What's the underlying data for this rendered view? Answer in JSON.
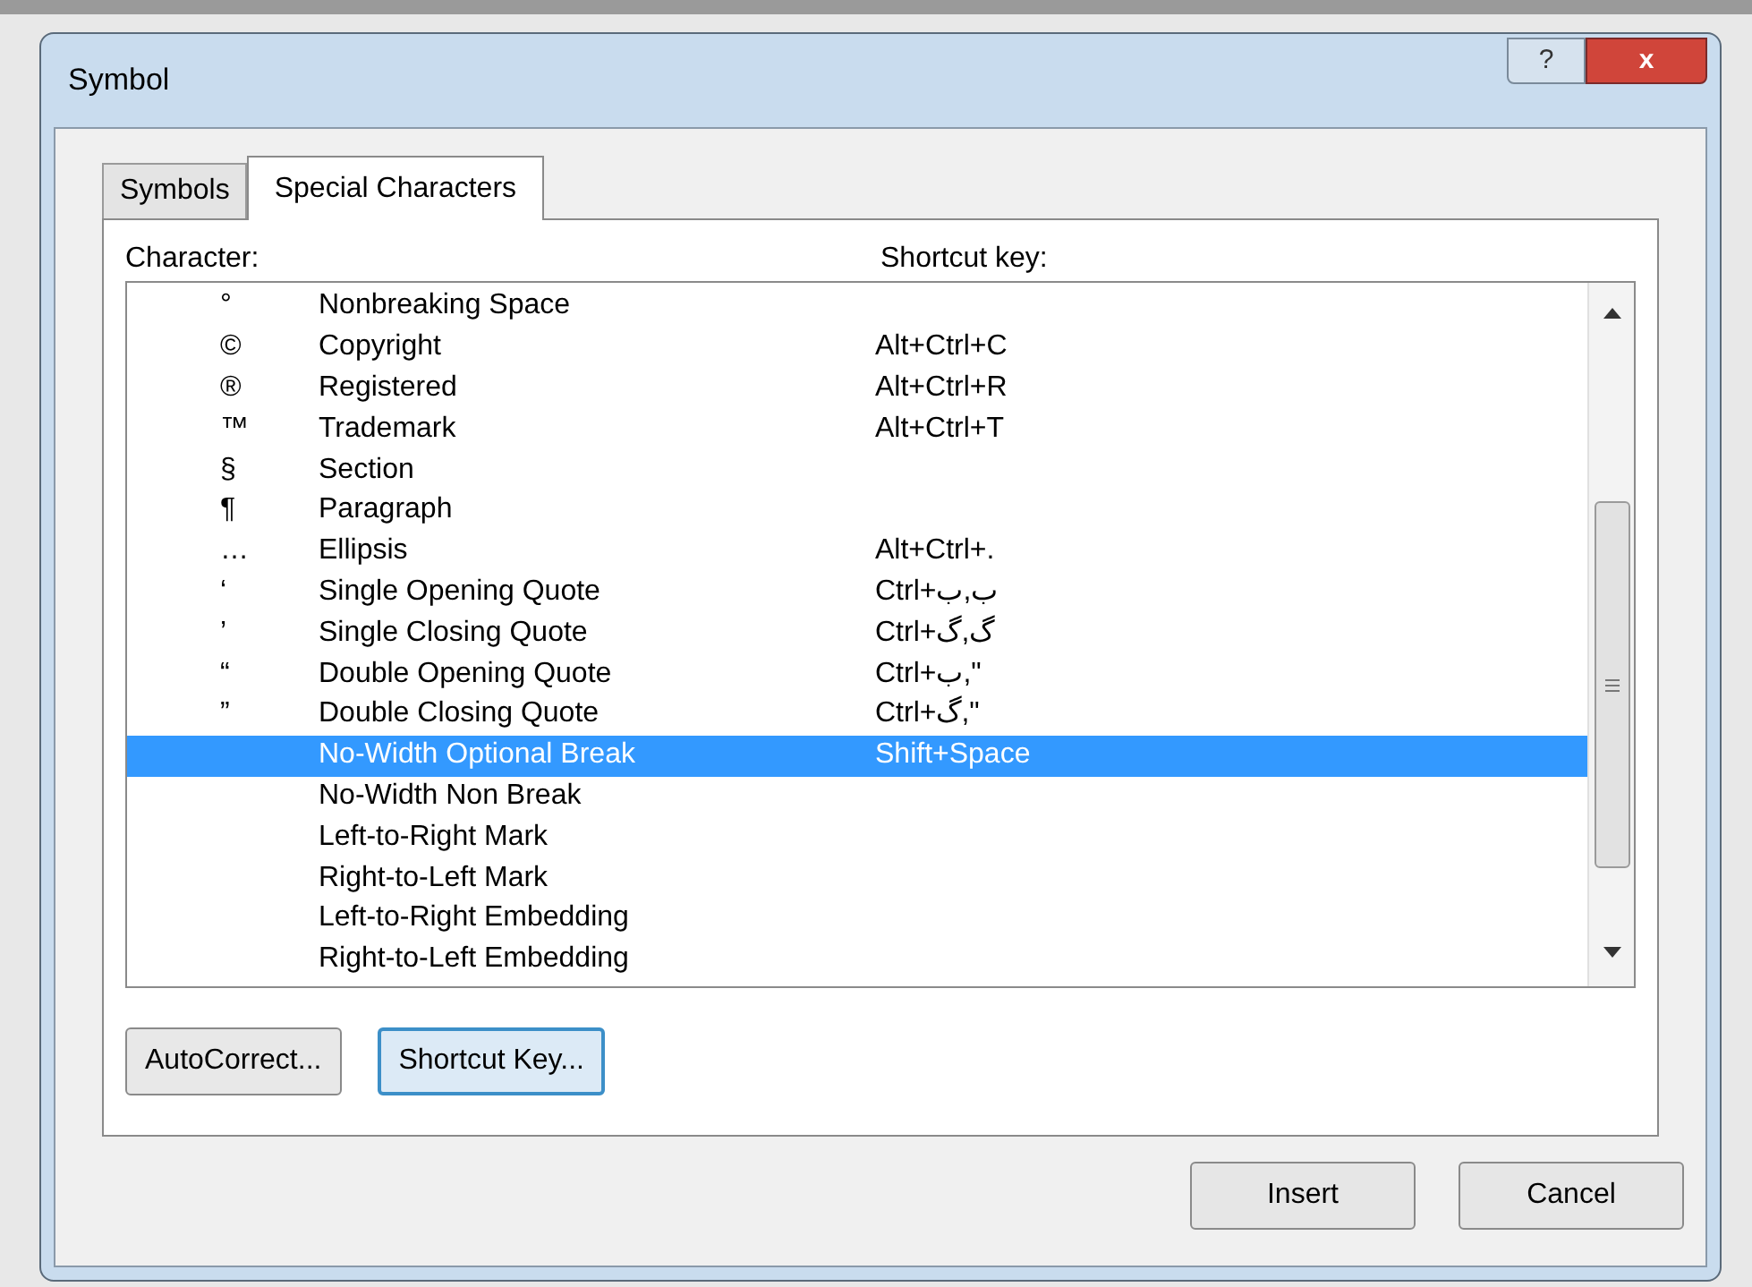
{
  "window": {
    "title": "Symbol",
    "help_button": "?",
    "close_button": "x"
  },
  "tabs": [
    {
      "label": "Symbols",
      "selected": false
    },
    {
      "label": "Special Characters",
      "selected": true
    }
  ],
  "columns": [
    "Character:",
    "Shortcut key:"
  ],
  "rows": [
    {
      "symbol": "°",
      "name": "Nonbreaking Space",
      "shortcut": "",
      "selected": false
    },
    {
      "symbol": "©",
      "name": "Copyright",
      "shortcut": "Alt+Ctrl+C",
      "selected": false
    },
    {
      "symbol": "®",
      "name": "Registered",
      "shortcut": "Alt+Ctrl+R",
      "selected": false
    },
    {
      "symbol": "™",
      "name": "Trademark",
      "shortcut": "Alt+Ctrl+T",
      "selected": false
    },
    {
      "symbol": "§",
      "name": "Section",
      "shortcut": "",
      "selected": false
    },
    {
      "symbol": "¶",
      "name": "Paragraph",
      "shortcut": "",
      "selected": false
    },
    {
      "symbol": "…",
      "name": "Ellipsis",
      "shortcut": "Alt+Ctrl+.",
      "selected": false
    },
    {
      "symbol": "‘",
      "name": "Single Opening Quote",
      "shortcut": "Ctrl+ب,ب",
      "selected": false
    },
    {
      "symbol": "’",
      "name": "Single Closing Quote",
      "shortcut": "Ctrl+گ,گ",
      "selected": false
    },
    {
      "symbol": "“",
      "name": "Double Opening Quote",
      "shortcut": "Ctrl+ب,\"",
      "selected": false
    },
    {
      "symbol": "”",
      "name": "Double Closing Quote",
      "shortcut": "Ctrl+گ,\"",
      "selected": false
    },
    {
      "symbol": "",
      "name": "No-Width Optional Break",
      "shortcut": "Shift+Space",
      "selected": true
    },
    {
      "symbol": "",
      "name": "No-Width Non Break",
      "shortcut": "",
      "selected": false
    },
    {
      "symbol": "",
      "name": "Left-to-Right Mark",
      "shortcut": "",
      "selected": false
    },
    {
      "symbol": "",
      "name": "Right-to-Left Mark",
      "shortcut": "",
      "selected": false
    },
    {
      "symbol": "",
      "name": "Left-to-Right Embedding",
      "shortcut": "",
      "selected": false
    },
    {
      "symbol": "",
      "name": "Right-to-Left Embedding",
      "shortcut": "",
      "selected": false
    }
  ],
  "panel_buttons": [
    {
      "label": "AutoCorrect...",
      "focused": false
    },
    {
      "label": "Shortcut Key...",
      "focused": true
    }
  ],
  "dialog_buttons": [
    "Insert",
    "Cancel"
  ]
}
